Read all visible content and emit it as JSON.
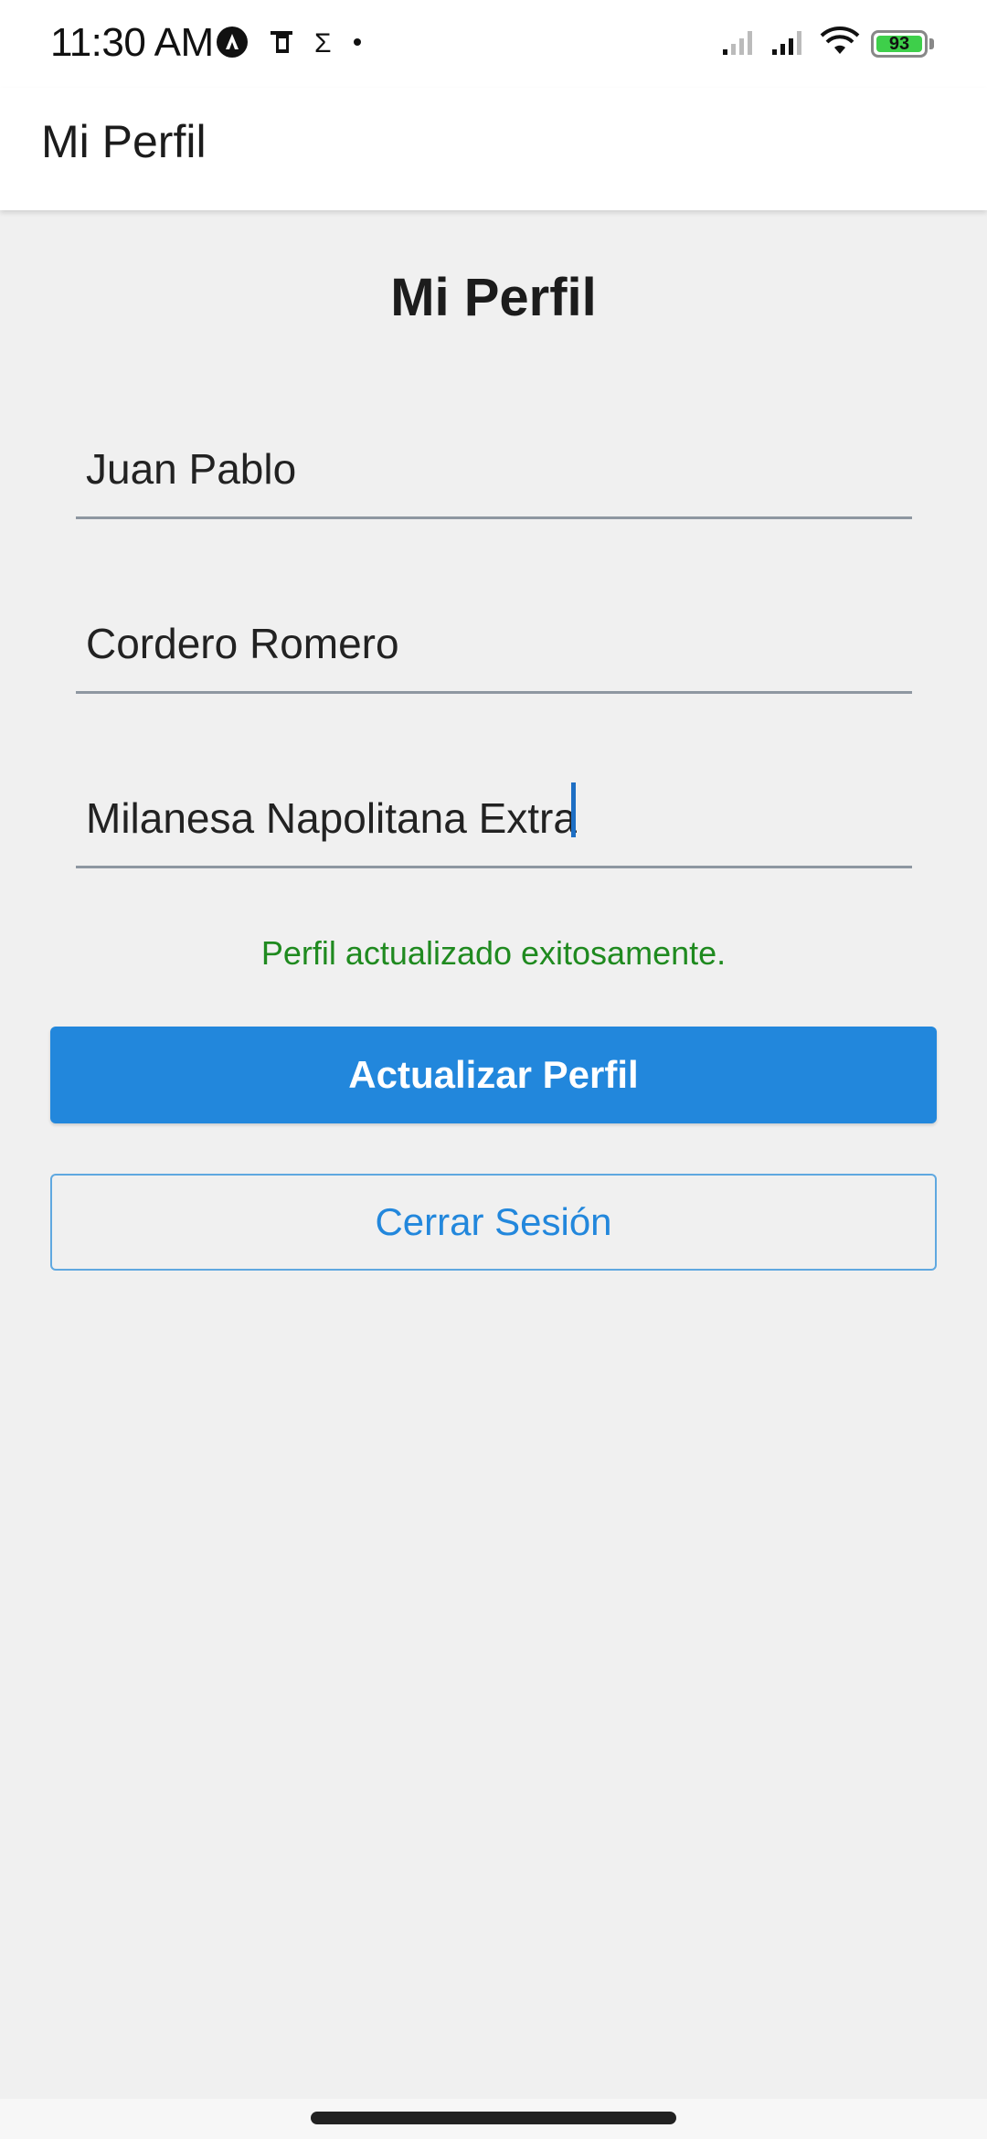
{
  "status_bar": {
    "time": "11:30 AM",
    "notification_icons": [
      "app-a-icon",
      "sim-card-icon",
      "sigma-icon",
      "dot-icon"
    ],
    "sigma_glyph": "Σ",
    "battery_level": "93",
    "battery_color": "#3ecf4a"
  },
  "app_bar": {
    "title": "Mi Perfil"
  },
  "main": {
    "title": "Mi Perfil",
    "fields": [
      {
        "value": "Juan Pablo"
      },
      {
        "value": "Cordero Romero"
      },
      {
        "value": "Milanesa Napolitana Extra"
      }
    ],
    "success_message": "Perfil actualizado exitosamente.",
    "update_button_label": "Actualizar Perfil",
    "logout_button_label": "Cerrar Sesión"
  },
  "colors": {
    "primary": "#2287dc",
    "success": "#1f8a1f",
    "background": "#f0f0f0"
  }
}
